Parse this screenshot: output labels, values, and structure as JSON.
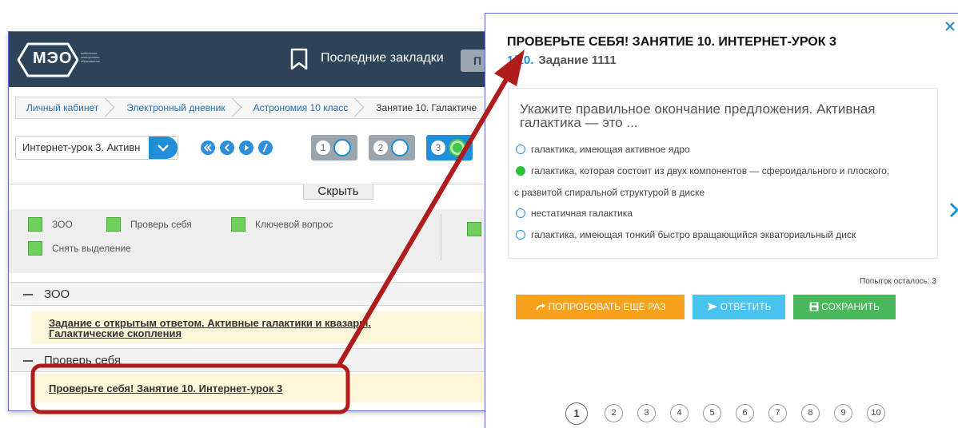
{
  "header": {
    "logo_text": "МЭО",
    "logo_tagline": "мобильное электронное образование",
    "bookmarks_label": "Последние закладки",
    "button_label": "П"
  },
  "breadcrumbs": [
    "Личный кабинет",
    "Электронный дневник",
    "Астрономия 10 класс",
    "Занятие 10. Галактиче"
  ],
  "lesson_selector": {
    "value": "Интернет-урок 3. Активн"
  },
  "steps": [
    {
      "number": "1",
      "active": false
    },
    {
      "number": "2",
      "active": false
    },
    {
      "number": "3",
      "active": true
    }
  ],
  "hide_button_label": "Скрыть",
  "legend": {
    "items": [
      "ЗОО",
      "Проверь себя",
      "Ключевой вопрос",
      "Снять выделение"
    ]
  },
  "groups": [
    {
      "title": "ЗОО",
      "task": "Задание с открытым ответом. Активные галактики и квазары. Галактические скопления"
    },
    {
      "title": "Проверь себя",
      "task": "Проверьте себя! Занятие 10. Интернет-урок 3"
    }
  ],
  "modal": {
    "title": "ПРОВЕРЬТЕ СЕБЯ! ЗАНЯТИЕ 10. ИНТЕРНЕТ-УРОК 3",
    "counter": "1/10.",
    "task_label": "Задание 1111",
    "question": "Укажите правильное окончание предложения. Активная галактика — это ...",
    "answers": [
      {
        "line1": "галактика, имеющая активное ядро",
        "selected": false
      },
      {
        "line1": "галактика, которая состоит из двух компонентов — сфероидального и плоского,",
        "line2": "с развитой спиральной структурой в диске",
        "selected": true
      },
      {
        "line1": "нестатичная галактика",
        "selected": false
      },
      {
        "line1": "галактика, имеющая тонкий быстро вращающийся экваториальный диск",
        "selected": false
      }
    ],
    "attempts_label": "Попыток осталось: 3",
    "retry_label": "ПОПРОБОВАТЬ ЕЩЕ РАЗ",
    "answer_label": "ОТВЕТИТЬ",
    "save_label": "СОХРАНИТЬ",
    "pages": [
      "1",
      "2",
      "3",
      "4",
      "5",
      "6",
      "7",
      "8",
      "9",
      "10"
    ],
    "current_page": "1"
  },
  "colors": {
    "header_bg": "#2d4458",
    "accent_blue": "#1e8fd8",
    "retry_orange": "#f7a11c",
    "answer_cyan": "#49c3f0",
    "save_green": "#49b85a",
    "selected_green": "#2ec23c",
    "highlight_red": "#b01c1c"
  }
}
